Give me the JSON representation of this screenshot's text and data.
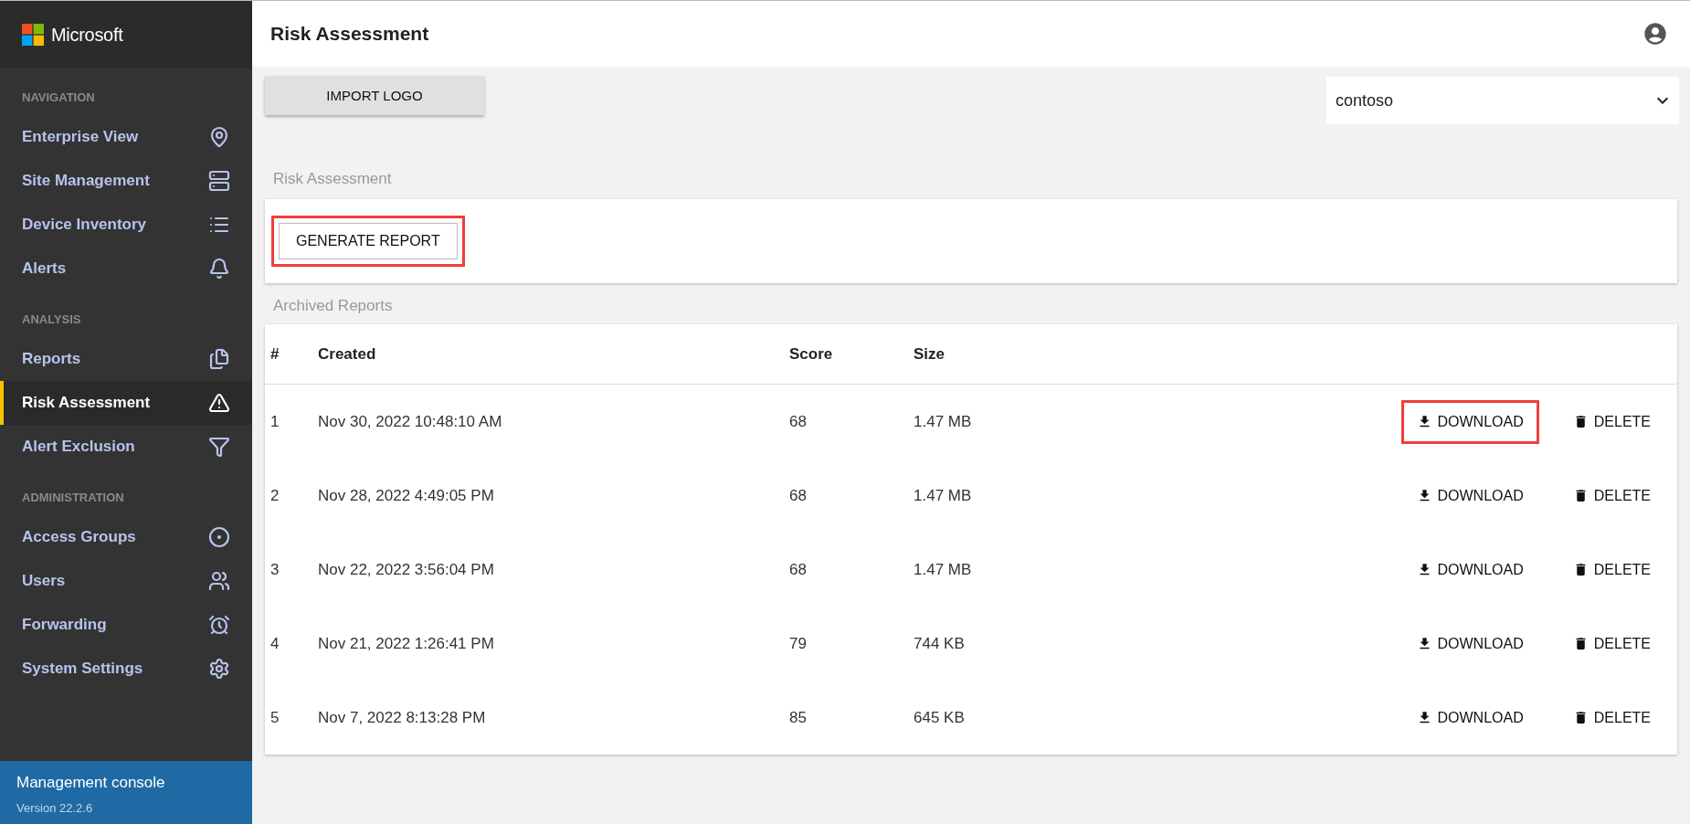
{
  "sidebar": {
    "brand": "Microsoft",
    "sections": [
      {
        "title": "NAVIGATION",
        "items": [
          {
            "label": "Enterprise View",
            "selected": false
          },
          {
            "label": "Site Management",
            "selected": false
          },
          {
            "label": "Device Inventory",
            "selected": false
          },
          {
            "label": "Alerts",
            "selected": false
          }
        ]
      },
      {
        "title": "ANALYSIS",
        "items": [
          {
            "label": "Reports",
            "selected": false
          },
          {
            "label": "Risk Assessment",
            "selected": true
          },
          {
            "label": "Alert Exclusion",
            "selected": false
          }
        ]
      },
      {
        "title": "ADMINISTRATION",
        "items": [
          {
            "label": "Access Groups",
            "selected": false
          },
          {
            "label": "Users",
            "selected": false
          },
          {
            "label": "Forwarding",
            "selected": false
          },
          {
            "label": "System Settings",
            "selected": false
          }
        ]
      }
    ],
    "footer": {
      "title": "Management console",
      "version": "Version 22.2.6"
    }
  },
  "header": {
    "title": "Risk Assessment"
  },
  "toolbar": {
    "import_button": "IMPORT LOGO",
    "site_select": {
      "value": "contoso"
    }
  },
  "risk_assessment": {
    "title": "Risk Assessment",
    "generate_button": {
      "label": "GENERATE REPORT",
      "highlighted": true
    }
  },
  "archived_reports": {
    "title": "Archived Reports",
    "columns": [
      "#",
      "Created",
      "Score",
      "Size"
    ],
    "rows": [
      {
        "number": "1",
        "created": "Nov 30, 2022 10:48:10 AM",
        "score": "68",
        "size": "1.47 MB",
        "download": "DOWNLOAD",
        "delete": "DELETE",
        "highlighted": true
      },
      {
        "number": "2",
        "created": "Nov 28, 2022 4:49:05 PM",
        "score": "68",
        "size": "1.47 MB",
        "download": "DOWNLOAD",
        "delete": "DELETE",
        "highlighted": false
      },
      {
        "number": "3",
        "created": "Nov 22, 2022 3:56:04 PM",
        "score": "68",
        "size": "1.47 MB",
        "download": "DOWNLOAD",
        "delete": "DELETE",
        "highlighted": false
      },
      {
        "number": "4",
        "created": "Nov 21, 2022 1:26:41 PM",
        "score": "79",
        "size": "744 KB",
        "download": "DOWNLOAD",
        "delete": "DELETE",
        "highlighted": false
      },
      {
        "number": "5",
        "created": "Nov 7, 2022 8:13:28 PM",
        "score": "85",
        "size": "645 KB",
        "download": "DOWNLOAD",
        "delete": "DELETE",
        "highlighted": false
      }
    ]
  }
}
